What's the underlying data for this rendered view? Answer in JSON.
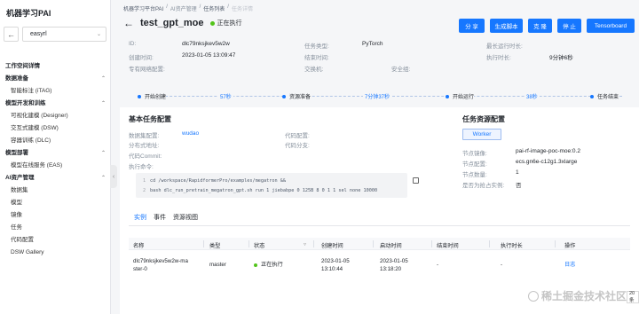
{
  "app": {
    "brand": "机器学习PAI"
  },
  "workspace": {
    "name": "easyrl"
  },
  "nav": {
    "overview": "工作空间详情",
    "group_data": "数据准备",
    "smart_label": "智能标注 (iTAG)",
    "group_dev": "模型开发和训练",
    "designer": "可视化建模 (Designer)",
    "dsw": "交互式建模 (DSW)",
    "dlc": "容器训练 (DLC)",
    "group_deploy": "模型部署",
    "eas": "模型在线服务 (EAS)",
    "group_assets": "AI资产管理",
    "datasets": "数据集",
    "models": "模型",
    "images": "镜像",
    "jobs": "任务",
    "code": "代码配置",
    "gallery": "DSW Gallery"
  },
  "breadcrumb": [
    "机器学习平台PAI",
    "AI资产管理",
    "任务列表",
    "任务详情"
  ],
  "job": {
    "name": "test_gpt_moe",
    "status": "正在执行",
    "status_color": "#52c41a"
  },
  "actions": [
    "分 享",
    "生成脚本",
    "克 隆",
    "停 止",
    "Tensorboard"
  ],
  "info": {
    "id_label": "ID:",
    "id": "dlc79nksjkev5w2w",
    "type_label": "任务类型:",
    "type": "PyTorch",
    "maxtime_label": "最长运行时长:",
    "maxtime": "",
    "created_label": "创建时间:",
    "created": "2023-01-05 13:09:47",
    "finished_label": "结束时间:",
    "finished": "",
    "duration_label": "执行时长:",
    "duration": "9分钟6秒",
    "vpc_label": "专有网络配置:",
    "vpc": "",
    "switch_label": "交换机:",
    "switch": "",
    "sg_label": "安全组:",
    "sg": ""
  },
  "timeline": {
    "steps": [
      "开始创建",
      "资源准备",
      "开始运行",
      "任务结束"
    ],
    "durations": [
      "57秒",
      "7分钟37秒",
      "38秒"
    ]
  },
  "basic": {
    "title": "基本任务配置",
    "dataset_label": "数据集配置:",
    "dataset": "wudao",
    "codeconf_label": "代码配置:",
    "codeconf": "",
    "mount_label": "分布式地址:",
    "mount": "",
    "branch_label": "代码分支:",
    "branch": "",
    "commit_label": "代码Commit:",
    "commit": "",
    "cmd_label": "执行命令:",
    "cmd_lines": [
      "cd /workspace/RapidformerPro/examples/megatron &&",
      "bash dlc_run_pretrain_megatron_gpt.sh run 1 jiebabpe 0 125B 8 0 1 1 sel none 10000"
    ]
  },
  "resources": {
    "title": "任务资源配置",
    "tag": "Worker",
    "image_label": "节点镜像:",
    "image": "pai-rf-image-poc-moe:0.2",
    "spec_label": "节点配置:",
    "spec": "ecs.gn6e-c12g1.3xlarge",
    "count_label": "节点数量:",
    "count": "1",
    "preempt_label": "是否为抢占实例:",
    "preempt": "否"
  },
  "tabs": [
    "实例",
    "事件",
    "资源视图"
  ],
  "table": {
    "headers": [
      "名称",
      "类型",
      "状态",
      "创建时间",
      "启动时间",
      "结束时间",
      "执行时长",
      "操作"
    ],
    "rows": [
      {
        "name_line1": "dlc79nksjkev5w2w-ma",
        "name_line2": "ster-0",
        "type": "master",
        "status": "正在执行",
        "created_date": "2023-01-05",
        "created_time": "13:10:44",
        "started_date": "2023-01-05",
        "started_time": "13:18:20",
        "finished": "-",
        "duration": "-",
        "action": "日志"
      }
    ]
  },
  "watermark": "稀土掘金技术社区",
  "pager_text": "20 条"
}
